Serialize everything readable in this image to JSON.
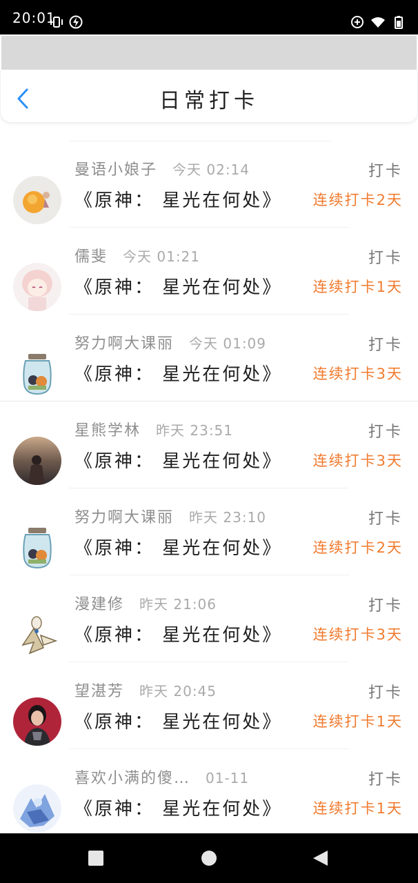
{
  "status_bar": {
    "time": "20:01"
  },
  "header": {
    "title": "日常打卡"
  },
  "list": [
    {
      "name": "曼语小娘子",
      "time": "今天 02:14",
      "topic": "《原神： 星光在何处》",
      "action": "打卡",
      "streak": "连续打卡2天",
      "avatar": "avatar-orange-fruit"
    },
    {
      "name": "儒斐",
      "time": "今天 01:21",
      "topic": "《原神： 星光在何处》",
      "action": "打卡",
      "streak": "连续打卡1天",
      "avatar": "avatar-anime-girl"
    },
    {
      "name": "努力啊大课丽",
      "time": "今天 01:09",
      "topic": "《原神： 星光在何处》",
      "action": "打卡",
      "streak": "连续打卡3天",
      "avatar": "avatar-jar"
    },
    {
      "name": "星熊学林",
      "time": "昨天 23:51",
      "topic": "《原神： 星光在何处》",
      "action": "打卡",
      "streak": "连续打卡3天",
      "avatar": "avatar-seaside"
    },
    {
      "name": "努力啊大课丽",
      "time": "昨天 23:10",
      "topic": "《原神： 星光在何处》",
      "action": "打卡",
      "streak": "连续打卡2天",
      "avatar": "avatar-jar"
    },
    {
      "name": "漫建修",
      "time": "昨天 21:06",
      "topic": "《原神： 星光在何处》",
      "action": "打卡",
      "streak": "连续打卡3天",
      "avatar": "avatar-pokemon"
    },
    {
      "name": "望湛芳",
      "time": "昨天 20:45",
      "topic": "《原神： 星光在何处》",
      "action": "打卡",
      "streak": "连续打卡1天",
      "avatar": "avatar-woman-red"
    },
    {
      "name": "喜欢小满的傻…",
      "time": "01-11",
      "topic": "《原神： 星光在何处》",
      "action": "打卡",
      "streak": "连续打卡1天",
      "avatar": "avatar-blue-figure"
    }
  ],
  "colors": {
    "accent_blue": "#2a8ff7",
    "streak_orange": "#f07a2e"
  },
  "system_nav": {
    "icons": [
      "square-icon",
      "circle-icon",
      "back-triangle-icon"
    ]
  }
}
